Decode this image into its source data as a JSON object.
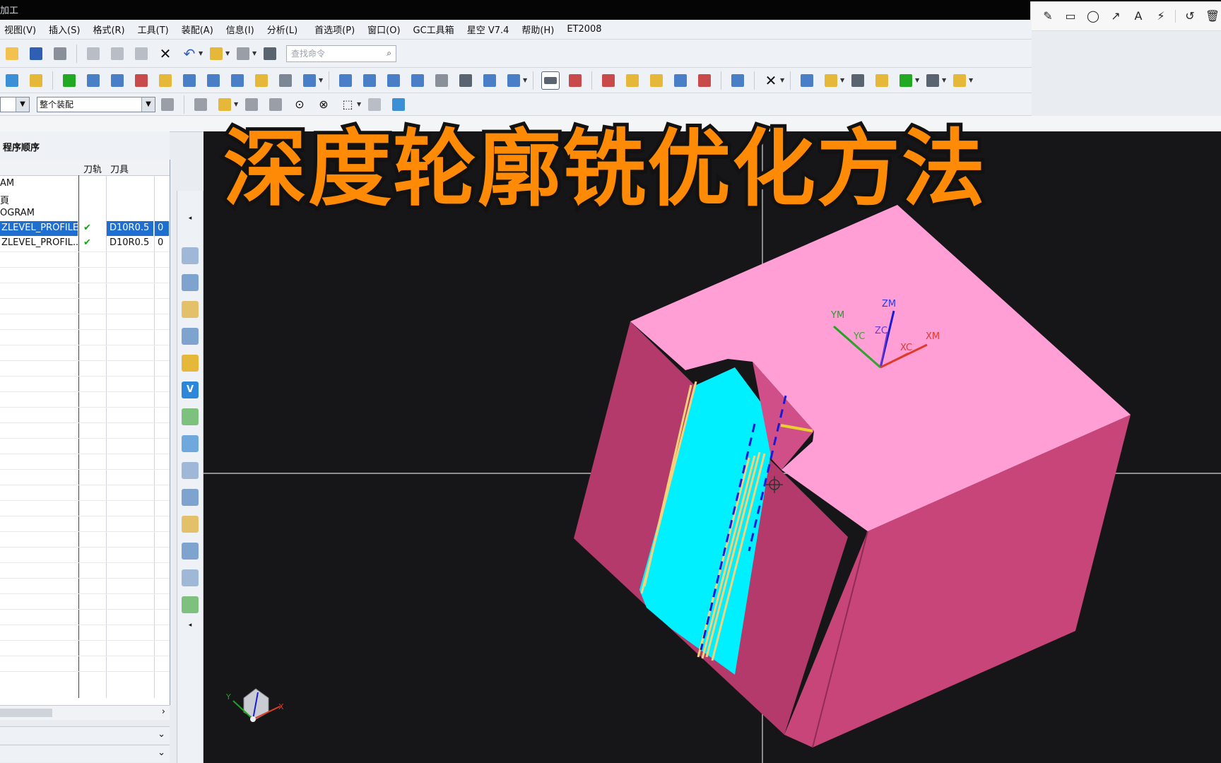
{
  "window": {
    "title_fragment": "加工"
  },
  "annotation_toolbar": {
    "icons": [
      "pencil-icon",
      "rectangle-icon",
      "circle-icon",
      "arrow-icon",
      "text-icon",
      "magic-wand-icon",
      "undo-icon",
      "trash-icon"
    ]
  },
  "menubar": {
    "items": [
      "视图(V)",
      "插入(S)",
      "格式(R)",
      "工具(T)",
      "装配(A)",
      "信息(I)",
      "分析(L)",
      "首选项(P)",
      "窗口(O)",
      "GC工具箱",
      "星空 V7.4",
      "帮助(H)",
      "ET2008"
    ]
  },
  "toolbar": {
    "search_placeholder": "查找命令",
    "assembly_filter": "整个装配"
  },
  "navigator": {
    "title": "程序顺序",
    "columns": [
      "刀轨",
      "刀具"
    ],
    "rows": [
      {
        "name": "AM",
        "check": "",
        "tool": "",
        "extra": ""
      },
      {
        "name": "頁",
        "check": "",
        "tool": "",
        "extra": ""
      },
      {
        "name": "OGRAM",
        "check": "",
        "tool": "",
        "extra": ""
      },
      {
        "name": "ZLEVEL_PROFILE",
        "check": "✔",
        "tool": "D10R0.5",
        "extra": "0",
        "selected": true
      },
      {
        "name": "ZLEVEL_PROFIL...",
        "check": "✔",
        "tool": "D10R0.5",
        "extra": "0"
      }
    ]
  },
  "viewport": {
    "csys_labels": {
      "zm": "ZM",
      "zc": "ZC",
      "ym": "YM",
      "yc": "YC",
      "xc": "XC",
      "xm": "XM"
    },
    "triad_labels": {
      "y": "Y",
      "x": "X"
    }
  },
  "banner": {
    "text": "深度轮廓铣优化方法"
  },
  "colors": {
    "model_top": "#ff9fd6",
    "model_side": "#c8457a",
    "wall": "#00f5ff",
    "toolpath": "#f3d27a",
    "banner_fill": "#ff8a05",
    "selection": "#1e6fd0"
  }
}
